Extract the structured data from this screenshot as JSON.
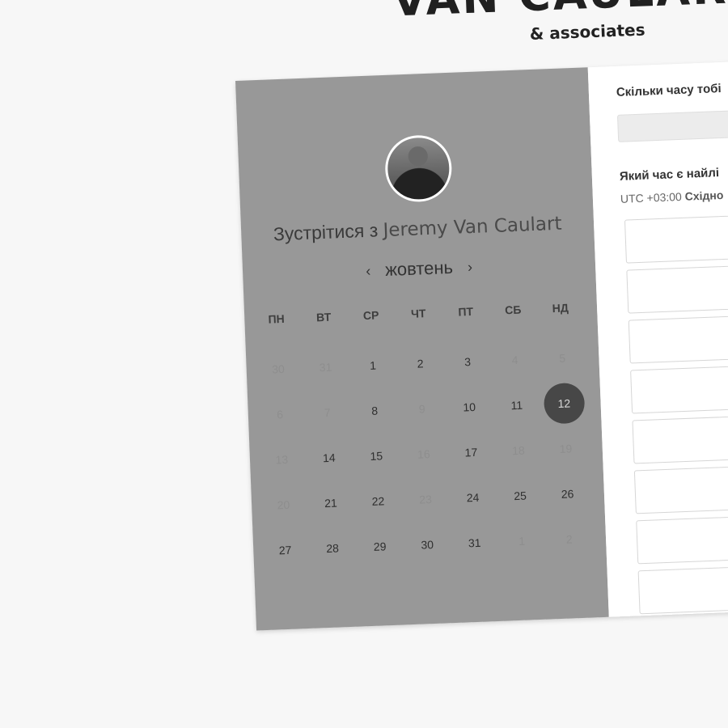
{
  "brand": {
    "name": "VAN CAULART",
    "subtitle": "& associates"
  },
  "left": {
    "title_prefix": "Зустрітися з",
    "host_name": "Jeremy Van Caulart",
    "month": "жовтень",
    "prev_icon": "chevron-left-icon",
    "next_icon": "chevron-right-icon",
    "weekdays": [
      "ПН",
      "ВТ",
      "СР",
      "ЧТ",
      "ПТ",
      "СБ",
      "НД"
    ],
    "days": [
      {
        "label": "30",
        "state": "muted"
      },
      {
        "label": "31",
        "state": "muted"
      },
      {
        "label": "1",
        "state": "available"
      },
      {
        "label": "2",
        "state": "available"
      },
      {
        "label": "3",
        "state": "available"
      },
      {
        "label": "4",
        "state": "muted"
      },
      {
        "label": "5",
        "state": "muted"
      },
      {
        "label": "6",
        "state": "muted"
      },
      {
        "label": "7",
        "state": "muted"
      },
      {
        "label": "8",
        "state": "available"
      },
      {
        "label": "9",
        "state": "muted"
      },
      {
        "label": "10",
        "state": "available"
      },
      {
        "label": "11",
        "state": "available"
      },
      {
        "label": "12",
        "state": "selected"
      },
      {
        "label": "13",
        "state": "muted"
      },
      {
        "label": "14",
        "state": "available"
      },
      {
        "label": "15",
        "state": "available"
      },
      {
        "label": "16",
        "state": "muted"
      },
      {
        "label": "17",
        "state": "available"
      },
      {
        "label": "18",
        "state": "muted"
      },
      {
        "label": "19",
        "state": "muted"
      },
      {
        "label": "20",
        "state": "muted"
      },
      {
        "label": "21",
        "state": "available"
      },
      {
        "label": "22",
        "state": "available"
      },
      {
        "label": "23",
        "state": "muted"
      },
      {
        "label": "24",
        "state": "available"
      },
      {
        "label": "25",
        "state": "available"
      },
      {
        "label": "26",
        "state": "available"
      },
      {
        "label": "27",
        "state": "available"
      },
      {
        "label": "28",
        "state": "available"
      },
      {
        "label": "29",
        "state": "available"
      },
      {
        "label": "30",
        "state": "available"
      },
      {
        "label": "31",
        "state": "available"
      },
      {
        "label": "1",
        "state": "muted"
      },
      {
        "label": "2",
        "state": "muted"
      }
    ]
  },
  "right": {
    "question_duration": "Скільки часу тобі",
    "question_time": "Який час є найлі",
    "timezone_offset": "UTC +03:00",
    "timezone_name": "Східно",
    "slot_count": 8
  },
  "colors": {
    "left_panel_bg": "#989898",
    "selected_day_bg": "#474747",
    "page_bg": "#f7f7f7"
  }
}
